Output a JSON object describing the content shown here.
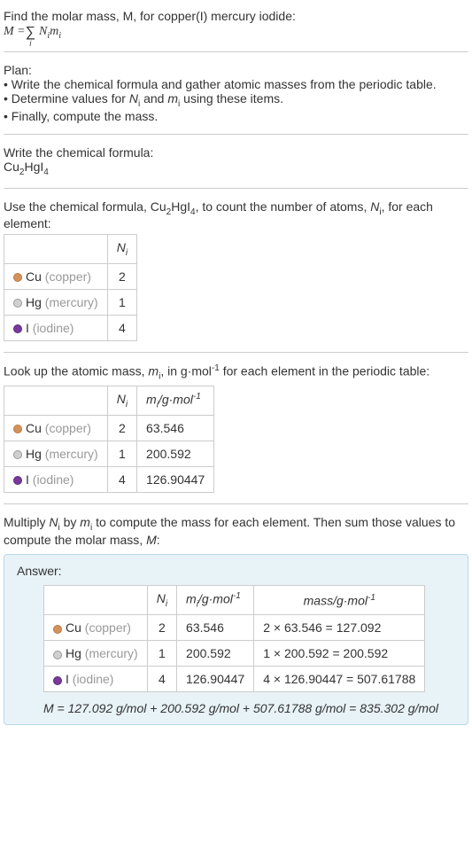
{
  "intro": {
    "line1": "Find the molar mass, M, for copper(I) mercury iodide:",
    "eq_lhs": "M = ",
    "eq_sigma": "∑",
    "eq_sub": "i",
    "eq_rhs": "Nᵢmᵢ"
  },
  "plan": {
    "heading": "Plan:",
    "items": [
      "Write the chemical formula and gather atomic masses from the periodic table.",
      "Determine values for Nᵢ and mᵢ using these items.",
      "Finally, compute the mass."
    ]
  },
  "step1": {
    "heading": "Write the chemical formula:",
    "formula": "Cu₂HgI₄"
  },
  "step2": {
    "heading": "Use the chemical formula, Cu₂HgI₄, to count the number of atoms, Nᵢ, for each element:",
    "header_ni": "Nᵢ",
    "rows": [
      {
        "dot": "dot-cu",
        "sym": "Cu",
        "label": "(copper)",
        "n": "2"
      },
      {
        "dot": "dot-hg",
        "sym": "Hg",
        "label": "(mercury)",
        "n": "1"
      },
      {
        "dot": "dot-i",
        "sym": "I",
        "label": "(iodine)",
        "n": "4"
      }
    ]
  },
  "step3": {
    "heading": "Look up the atomic mass, mᵢ, in g·mol⁻¹ for each element in the periodic table:",
    "header_ni": "Nᵢ",
    "header_mi": "mᵢ/g·mol⁻¹",
    "rows": [
      {
        "dot": "dot-cu",
        "sym": "Cu",
        "label": "(copper)",
        "n": "2",
        "m": "63.546"
      },
      {
        "dot": "dot-hg",
        "sym": "Hg",
        "label": "(mercury)",
        "n": "1",
        "m": "200.592"
      },
      {
        "dot": "dot-i",
        "sym": "I",
        "label": "(iodine)",
        "n": "4",
        "m": "126.90447"
      }
    ]
  },
  "step4": {
    "heading": "Multiply Nᵢ by mᵢ to compute the mass for each element. Then sum those values to compute the molar mass, M:"
  },
  "answer": {
    "title": "Answer:",
    "header_ni": "Nᵢ",
    "header_mi": "mᵢ/g·mol⁻¹",
    "header_mass": "mass/g·mol⁻¹",
    "rows": [
      {
        "dot": "dot-cu",
        "sym": "Cu",
        "label": "(copper)",
        "n": "2",
        "m": "63.546",
        "mass": "2 × 63.546 = 127.092"
      },
      {
        "dot": "dot-hg",
        "sym": "Hg",
        "label": "(mercury)",
        "n": "1",
        "m": "200.592",
        "mass": "1 × 200.592 = 200.592"
      },
      {
        "dot": "dot-i",
        "sym": "I",
        "label": "(iodine)",
        "n": "4",
        "m": "126.90447",
        "mass": "4 × 126.90447 = 507.61788"
      }
    ],
    "final": "M = 127.092 g/mol + 200.592 g/mol + 507.61788 g/mol = 835.302 g/mol"
  }
}
